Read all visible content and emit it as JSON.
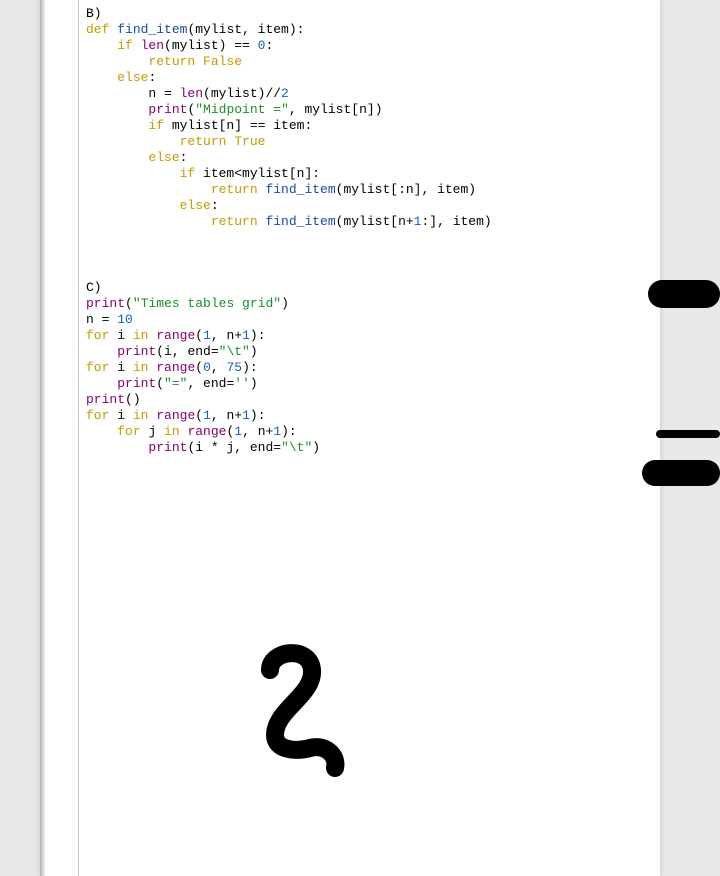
{
  "sectionB": {
    "label": "B)",
    "code": [
      {
        "type": "line",
        "tokens": [
          {
            "c": "name",
            "t": "B)"
          }
        ]
      },
      {
        "type": "line",
        "tokens": [
          {
            "c": "kw",
            "t": "def "
          },
          {
            "c": "fn",
            "t": "find_item"
          },
          {
            "c": "op",
            "t": "(mylist, item):"
          }
        ]
      },
      {
        "type": "line",
        "tokens": [
          {
            "c": "op",
            "t": "    "
          },
          {
            "c": "kw",
            "t": "if "
          },
          {
            "c": "bi",
            "t": "len"
          },
          {
            "c": "op",
            "t": "(mylist) == "
          },
          {
            "c": "num",
            "t": "0"
          },
          {
            "c": "op",
            "t": ":"
          }
        ]
      },
      {
        "type": "line",
        "tokens": [
          {
            "c": "op",
            "t": "        "
          },
          {
            "c": "kw",
            "t": "return "
          },
          {
            "c": "kw",
            "t": "False"
          }
        ]
      },
      {
        "type": "line",
        "tokens": [
          {
            "c": "op",
            "t": "    "
          },
          {
            "c": "kw",
            "t": "else"
          },
          {
            "c": "op",
            "t": ":"
          }
        ]
      },
      {
        "type": "line",
        "tokens": [
          {
            "c": "op",
            "t": "        n = "
          },
          {
            "c": "bi",
            "t": "len"
          },
          {
            "c": "op",
            "t": "(mylist)//"
          },
          {
            "c": "num",
            "t": "2"
          }
        ]
      },
      {
        "type": "line",
        "tokens": [
          {
            "c": "op",
            "t": "        "
          },
          {
            "c": "bi",
            "t": "print"
          },
          {
            "c": "op",
            "t": "("
          },
          {
            "c": "str",
            "t": "\"Midpoint =\""
          },
          {
            "c": "op",
            "t": ", mylist[n])"
          }
        ]
      },
      {
        "type": "line",
        "tokens": [
          {
            "c": "op",
            "t": "        "
          },
          {
            "c": "kw",
            "t": "if "
          },
          {
            "c": "op",
            "t": "mylist[n] == item:"
          }
        ]
      },
      {
        "type": "line",
        "tokens": [
          {
            "c": "op",
            "t": "            "
          },
          {
            "c": "kw",
            "t": "return "
          },
          {
            "c": "kw",
            "t": "True"
          }
        ]
      },
      {
        "type": "line",
        "tokens": [
          {
            "c": "op",
            "t": "        "
          },
          {
            "c": "kw",
            "t": "else"
          },
          {
            "c": "op",
            "t": ":"
          }
        ]
      },
      {
        "type": "line",
        "tokens": [
          {
            "c": "op",
            "t": "            "
          },
          {
            "c": "kw",
            "t": "if "
          },
          {
            "c": "op",
            "t": "item<mylist[n]:"
          }
        ]
      },
      {
        "type": "line",
        "tokens": [
          {
            "c": "op",
            "t": "                "
          },
          {
            "c": "kw",
            "t": "return "
          },
          {
            "c": "fn",
            "t": "find_item"
          },
          {
            "c": "op",
            "t": "(mylist[:n], item)"
          }
        ]
      },
      {
        "type": "line",
        "tokens": [
          {
            "c": "op",
            "t": "            "
          },
          {
            "c": "kw",
            "t": "else"
          },
          {
            "c": "op",
            "t": ":"
          }
        ]
      },
      {
        "type": "line",
        "tokens": [
          {
            "c": "op",
            "t": "                "
          },
          {
            "c": "kw",
            "t": "return "
          },
          {
            "c": "fn",
            "t": "find_item"
          },
          {
            "c": "op",
            "t": "(mylist[n+"
          },
          {
            "c": "num",
            "t": "1"
          },
          {
            "c": "op",
            "t": ":], item)"
          }
        ]
      }
    ]
  },
  "sectionC": {
    "label": "C)",
    "code": [
      {
        "type": "line",
        "tokens": [
          {
            "c": "name",
            "t": "C)"
          }
        ]
      },
      {
        "type": "line",
        "tokens": [
          {
            "c": "bi",
            "t": "print"
          },
          {
            "c": "op",
            "t": "("
          },
          {
            "c": "str",
            "t": "\"Times tables grid\""
          },
          {
            "c": "op",
            "t": ")"
          }
        ]
      },
      {
        "type": "line",
        "tokens": [
          {
            "c": "op",
            "t": "n = "
          },
          {
            "c": "num",
            "t": "10"
          }
        ]
      },
      {
        "type": "line",
        "tokens": [
          {
            "c": "kw",
            "t": "for "
          },
          {
            "c": "op",
            "t": "i "
          },
          {
            "c": "kw",
            "t": "in "
          },
          {
            "c": "bi",
            "t": "range"
          },
          {
            "c": "op",
            "t": "("
          },
          {
            "c": "num",
            "t": "1"
          },
          {
            "c": "op",
            "t": ", n+"
          },
          {
            "c": "num",
            "t": "1"
          },
          {
            "c": "op",
            "t": "):"
          }
        ]
      },
      {
        "type": "line",
        "tokens": [
          {
            "c": "op",
            "t": "    "
          },
          {
            "c": "bi",
            "t": "print"
          },
          {
            "c": "op",
            "t": "(i, end="
          },
          {
            "c": "str",
            "t": "\"\\t\""
          },
          {
            "c": "op",
            "t": ")"
          }
        ]
      },
      {
        "type": "line",
        "tokens": [
          {
            "c": "kw",
            "t": "for "
          },
          {
            "c": "op",
            "t": "i "
          },
          {
            "c": "kw",
            "t": "in "
          },
          {
            "c": "bi",
            "t": "range"
          },
          {
            "c": "op",
            "t": "("
          },
          {
            "c": "num",
            "t": "0"
          },
          {
            "c": "op",
            "t": ", "
          },
          {
            "c": "num",
            "t": "75"
          },
          {
            "c": "op",
            "t": "):"
          }
        ]
      },
      {
        "type": "line",
        "tokens": [
          {
            "c": "op",
            "t": "    "
          },
          {
            "c": "bi",
            "t": "print"
          },
          {
            "c": "op",
            "t": "("
          },
          {
            "c": "str",
            "t": "\"=\""
          },
          {
            "c": "op",
            "t": ", end="
          },
          {
            "c": "str",
            "t": "''"
          },
          {
            "c": "op",
            "t": ")"
          }
        ]
      },
      {
        "type": "line",
        "tokens": [
          {
            "c": "bi",
            "t": "print"
          },
          {
            "c": "op",
            "t": "()"
          }
        ]
      },
      {
        "type": "line",
        "tokens": [
          {
            "c": "kw",
            "t": "for "
          },
          {
            "c": "op",
            "t": "i "
          },
          {
            "c": "kw",
            "t": "in "
          },
          {
            "c": "bi",
            "t": "range"
          },
          {
            "c": "op",
            "t": "("
          },
          {
            "c": "num",
            "t": "1"
          },
          {
            "c": "op",
            "t": ", n+"
          },
          {
            "c": "num",
            "t": "1"
          },
          {
            "c": "op",
            "t": "):"
          }
        ]
      },
      {
        "type": "line",
        "tokens": [
          {
            "c": "op",
            "t": "    "
          },
          {
            "c": "kw",
            "t": "for "
          },
          {
            "c": "op",
            "t": "j "
          },
          {
            "c": "kw",
            "t": "in "
          },
          {
            "c": "bi",
            "t": "range"
          },
          {
            "c": "op",
            "t": "("
          },
          {
            "c": "num",
            "t": "1"
          },
          {
            "c": "op",
            "t": ", n+"
          },
          {
            "c": "num",
            "t": "1"
          },
          {
            "c": "op",
            "t": "):"
          }
        ]
      },
      {
        "type": "line",
        "tokens": [
          {
            "c": "op",
            "t": "        "
          },
          {
            "c": "bi",
            "t": "print"
          },
          {
            "c": "op",
            "t": "(i * j, end="
          },
          {
            "c": "str",
            "t": "\"\\t\""
          },
          {
            "c": "op",
            "t": ")"
          }
        ]
      }
    ]
  },
  "handwriting_label": "2"
}
